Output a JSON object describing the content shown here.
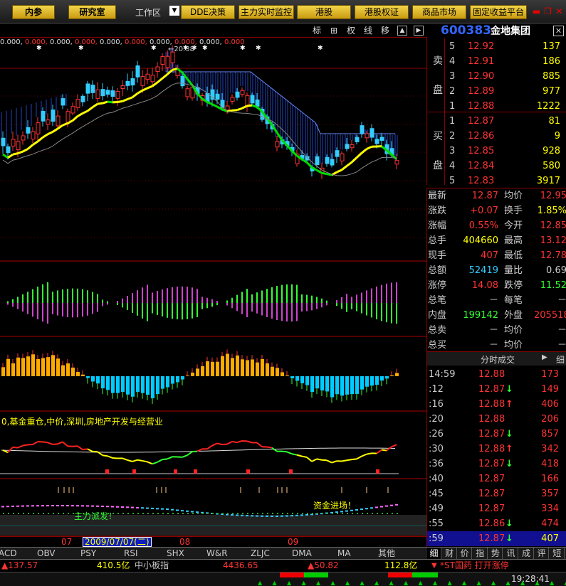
{
  "toolbar": {
    "btn_neican": "内参",
    "btn_research": "研究室",
    "workspace": "工作区",
    "workspace_arrow": "▼",
    "btn_dde": "DDE决策",
    "btn_monitor": "主力实时监控",
    "btn_hk": "港股",
    "btn_hkwarrant": "港股权证",
    "btn_commodity": "商品市场",
    "btn_fixed": "固定收益平台",
    "win_min": "▬",
    "win_restore": "❐",
    "win_close": "✕"
  },
  "chart_toolbar": {
    "biao": "标",
    "cross": "⊞",
    "quan": "权",
    "xian": "线",
    "yi": "移",
    "box1": "▲",
    "box2": "▶"
  },
  "stock": {
    "code": "600383",
    "name": "金地集团",
    "close": "✕"
  },
  "price_tags": [
    "0.000,",
    "0.000,",
    "0.000,",
    "0.000,",
    "0.000,",
    "0.000,",
    "0.000,",
    "0.000,",
    "0.000,",
    "0.000"
  ],
  "price_marker": "←20.38",
  "fund_title": "0,基金重仓,中价,深圳,房地产开发与经营业",
  "annotations": {
    "zhuli": "主力派发！",
    "zijin": "资金进场！"
  },
  "date_axis": {
    "m07": "07",
    "cursor": "2009/07/07(二)",
    "m08": "08",
    "m09": "09"
  },
  "indicator_tabs": [
    "ACD",
    "OBV",
    "PSY",
    "RSI",
    "SHX",
    "W&R",
    "ZLJC",
    "DMA",
    "MA",
    "其他"
  ],
  "order_book": {
    "sell_label_top": "卖",
    "sell_label_bottom": "盘",
    "buy_label_top": "买",
    "buy_label_bottom": "盘",
    "asks": [
      {
        "level": "5",
        "price": "12.92",
        "vol": "137"
      },
      {
        "level": "4",
        "price": "12.91",
        "vol": "186"
      },
      {
        "level": "3",
        "price": "12.90",
        "vol": "885"
      },
      {
        "level": "2",
        "price": "12.89",
        "vol": "977"
      },
      {
        "level": "1",
        "price": "12.88",
        "vol": "1222"
      }
    ],
    "bids": [
      {
        "level": "1",
        "price": "12.87",
        "vol": "81"
      },
      {
        "level": "2",
        "price": "12.86",
        "vol": "9"
      },
      {
        "level": "3",
        "price": "12.85",
        "vol": "928"
      },
      {
        "level": "4",
        "price": "12.84",
        "vol": "580"
      },
      {
        "level": "5",
        "price": "12.83",
        "vol": "3917"
      }
    ]
  },
  "quote_stats": [
    {
      "l1": "最新",
      "v1": "12.87",
      "c1": "#ff3333",
      "l2": "均价",
      "v2": "12.95",
      "c2": "#ff3333"
    },
    {
      "l1": "涨跌",
      "v1": "+0.07",
      "c1": "#ff3333",
      "l2": "换手",
      "v2": "1.85%",
      "c2": "#ffff00"
    },
    {
      "l1": "涨幅",
      "v1": "0.55%",
      "c1": "#ff3333",
      "l2": "今开",
      "v2": "12.85",
      "c2": "#ff3333"
    },
    {
      "l1": "总手",
      "v1": "404660",
      "c1": "#ffff00",
      "l2": "最高",
      "v2": "13.12",
      "c2": "#ff3333"
    },
    {
      "l1": "现手",
      "v1": "407",
      "c1": "#ff3333",
      "l2": "最低",
      "v2": "12.78",
      "c2": "#ff3333"
    },
    {
      "l1": "总额",
      "v1": "52419",
      "c1": "#33ccff",
      "l2": "量比",
      "v2": "0.69",
      "c2": "#cccccc"
    },
    {
      "l1": "涨停",
      "v1": "14.08",
      "c1": "#ff3333",
      "l2": "跌停",
      "v2": "11.52",
      "c2": "#33ff33"
    },
    {
      "l1": "总笔",
      "v1": "－",
      "c1": "#cccccc",
      "l2": "每笔",
      "v2": "－",
      "c2": "#cccccc"
    },
    {
      "l1": "内盘",
      "v1": "199142",
      "c1": "#33ff33",
      "l2": "外盘",
      "v2": "205518",
      "c2": "#ff3333"
    },
    {
      "l1": "总卖",
      "v1": "－",
      "c1": "#cccccc",
      "l2": "均价",
      "v2": "－",
      "c2": "#cccccc"
    },
    {
      "l1": "总买",
      "v1": "－",
      "c1": "#cccccc",
      "l2": "均价",
      "v2": "－",
      "c2": "#cccccc"
    }
  ],
  "trades_header": {
    "title": "分时成交",
    "arrow": "▶",
    "more": "细"
  },
  "trades": [
    {
      "time": "14:59",
      "price": "12.88",
      "arrow": "",
      "ac": "#ff3333",
      "vol": "173",
      "vc": "#ff3333"
    },
    {
      "time": ":12",
      "price": "12.87",
      "arrow": "↓",
      "ac": "#33ff33",
      "vol": "149",
      "vc": "#ff3333"
    },
    {
      "time": ":16",
      "price": "12.88",
      "arrow": "↑",
      "ac": "#ff3333",
      "vol": "406",
      "vc": "#ff3333"
    },
    {
      "time": ":20",
      "price": "12.88",
      "arrow": "",
      "ac": "#ff3333",
      "vol": "206",
      "vc": "#ff3333"
    },
    {
      "time": ":26",
      "price": "12.87",
      "arrow": "↓",
      "ac": "#33ff33",
      "vol": "857",
      "vc": "#ff3333"
    },
    {
      "time": ":30",
      "price": "12.88",
      "arrow": "↑",
      "ac": "#ff3333",
      "vol": "342",
      "vc": "#ff3333"
    },
    {
      "time": ":36",
      "price": "12.87",
      "arrow": "↓",
      "ac": "#33ff33",
      "vol": "418",
      "vc": "#ff3333"
    },
    {
      "time": ":40",
      "price": "12.87",
      "arrow": "",
      "ac": "#ff3333",
      "vol": "166",
      "vc": "#ff3333"
    },
    {
      "time": ":45",
      "price": "12.87",
      "arrow": "",
      "ac": "#ff3333",
      "vol": "357",
      "vc": "#ff3333"
    },
    {
      "time": ":49",
      "price": "12.87",
      "arrow": "",
      "ac": "#ff3333",
      "vol": "334",
      "vc": "#ff3333"
    },
    {
      "time": ":55",
      "price": "12.86",
      "arrow": "↓",
      "ac": "#33ff33",
      "vol": "474",
      "vc": "#ff3333"
    },
    {
      "time": ":59",
      "price": "12.87",
      "arrow": "↓",
      "ac": "#33ff33",
      "vol": "407",
      "vc": "#ffff00"
    }
  ],
  "side_tabs": [
    "细",
    "财",
    "价",
    "指",
    "势",
    "讯",
    "成",
    "评",
    "短"
  ],
  "status1": {
    "idx1": "▲137.57",
    "amt1": "410.5亿",
    "idx2_name": "中小板指",
    "idx2_val": "4436.65",
    "idx2_chg": "▲50.82",
    "amt2": "112.8亿",
    "alert_icon": "▼",
    "alert": "*ST国药 打开涨停"
  },
  "status2": {
    "clock": "19:28:41"
  },
  "colors": {
    "red": "#ff3333",
    "green": "#33ff33",
    "yellow": "#ffff00",
    "blue": "#3366ff",
    "cyan": "#33ccff",
    "magenta": "#cc44cc"
  },
  "chart_data": [
    {
      "type": "candlestick",
      "panel": "price",
      "series": [
        {
          "name": "price"
        },
        {
          "name": "ma-yellow-green"
        },
        {
          "name": "ma-gray"
        },
        {
          "name": "upper-band"
        }
      ],
      "annotations": [
        "←20.38"
      ],
      "grid": true
    },
    {
      "type": "bar",
      "panel": "oscillator-green-magenta"
    },
    {
      "type": "bar",
      "panel": "oscillator-orange-cyan"
    },
    {
      "type": "line",
      "panel": "fund-flow",
      "title": "0,基金重仓,中价,深圳,房地产开发与经营业"
    },
    {
      "type": "line",
      "panel": "capital-flow",
      "annotations": [
        "主力派发！",
        "资金进场！"
      ]
    }
  ]
}
